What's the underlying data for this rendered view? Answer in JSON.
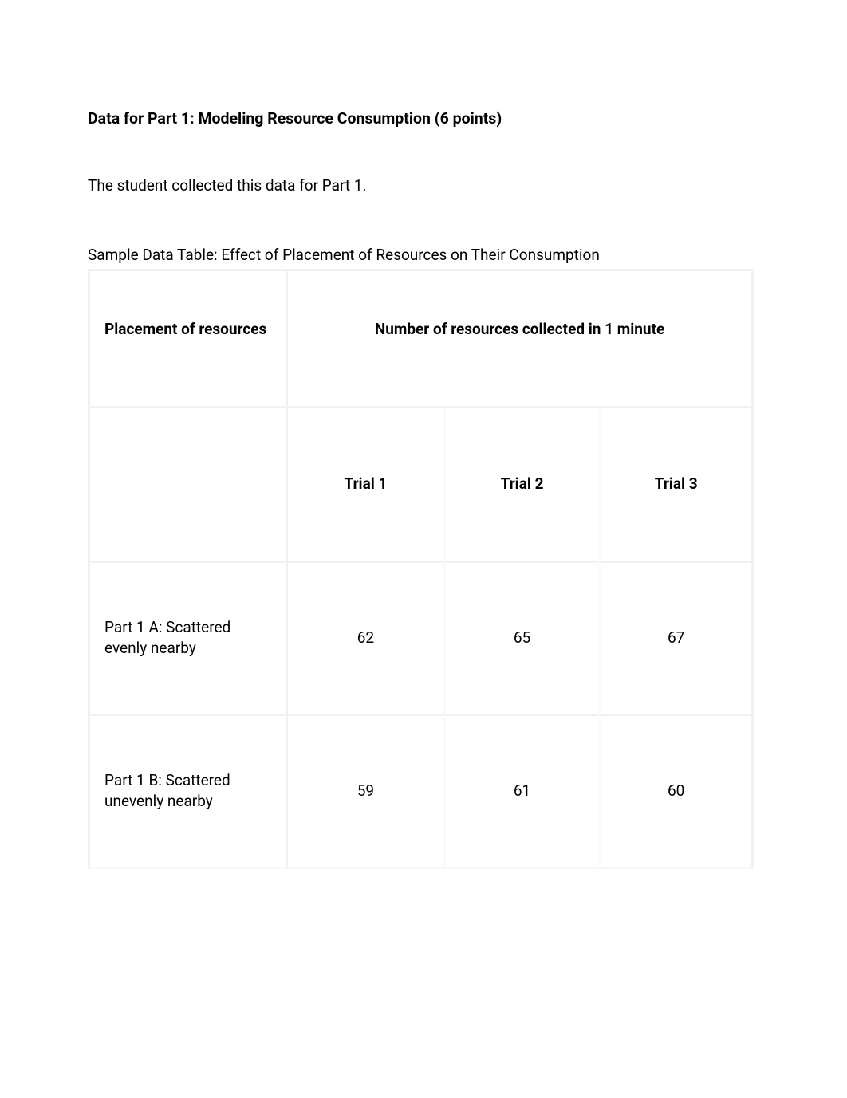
{
  "heading": "Data for Part 1: Modeling Resource Consumption (6 points)",
  "intro": "The student collected this data for Part 1.",
  "table_caption": "Sample Data Table: Effect of Placement of Resources on Their Consumption",
  "table": {
    "row_header_label": "Placement of resources",
    "merged_header": "Number of resources collected in 1 minute",
    "sub_headers": [
      "Trial 1",
      "Trial 2",
      "Trial 3"
    ],
    "rows": [
      {
        "label": "Part 1 A: Scattered evenly nearby",
        "values": [
          "62",
          "65",
          "67"
        ]
      },
      {
        "label": "Part 1 B: Scattered unevenly nearby",
        "values": [
          "59",
          "61",
          "60"
        ]
      }
    ]
  },
  "chart_data": {
    "type": "table",
    "title": "Effect of Placement of Resources on Their Consumption",
    "row_header": "Placement of resources",
    "column_group": "Number of resources collected in 1 minute",
    "columns": [
      "Trial 1",
      "Trial 2",
      "Trial 3"
    ],
    "rows": [
      {
        "label": "Part 1 A: Scattered evenly nearby",
        "values": [
          62,
          65,
          67
        ]
      },
      {
        "label": "Part 1 B: Scattered unevenly nearby",
        "values": [
          59,
          61,
          60
        ]
      }
    ]
  }
}
